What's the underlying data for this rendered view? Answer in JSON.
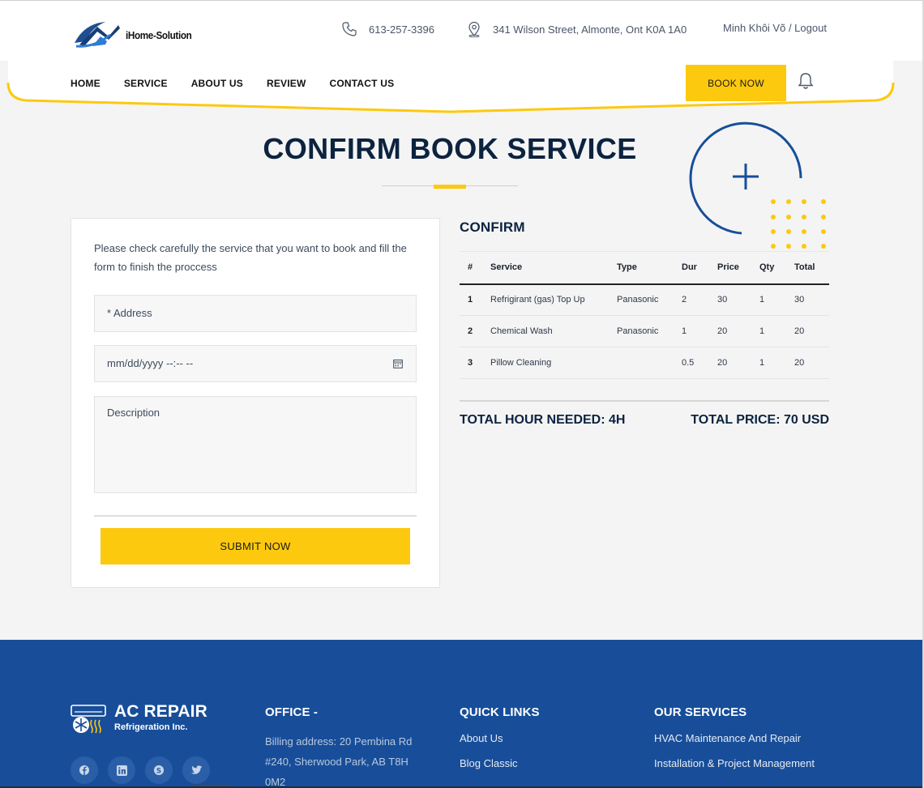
{
  "header": {
    "logo_text": "iHome-Solution",
    "phone": "613-257-3396",
    "address": "341 Wilson Street, Almonte, Ont K0A 1A0",
    "user_name": "Minh Khôi Võ",
    "separator": " / ",
    "logout": "Logout"
  },
  "nav": {
    "items": [
      "HOME",
      "SERVICE",
      "ABOUT US",
      "REVIEW",
      "CONTACT US"
    ],
    "book_now": "BOOK NOW",
    "icons": [
      "bell-icon",
      "phone-icon",
      "location-icon"
    ]
  },
  "page": {
    "title": "CONFIRM BOOK SERVICE"
  },
  "form": {
    "intro": "Please check carefully the service that you want to book and fill the form to finish the proccess",
    "address_placeholder": "* Address",
    "date_placeholder": "mm/dd/yyyy --:-- --",
    "description_placeholder": "Description",
    "submit": "SUBMIT NOW"
  },
  "confirm": {
    "title": "CONFIRM",
    "columns": [
      "#",
      "Service",
      "Type",
      "Dur",
      "Price",
      "Qty",
      "Total"
    ],
    "rows": [
      [
        "1",
        "Refrigirant (gas) Top Up",
        "Panasonic",
        "2",
        "30",
        "1",
        "30"
      ],
      [
        "2",
        "Chemical Wash",
        "Panasonic",
        "1",
        "20",
        "1",
        "20"
      ],
      [
        "3",
        "Pillow Cleaning",
        "",
        "0.5",
        "20",
        "1",
        "20"
      ]
    ],
    "total_hours": "TOTAL HOUR NEEDED: 4H",
    "total_price": "TOTAL PRICE: 70 USD"
  },
  "footer": {
    "brand": "AC REPAIR",
    "brand_sub": "Refrigeration Inc.",
    "office_heading": "OFFICE -",
    "office_text": "Billing address: 20 Pembina Rd #240, Sherwood Park, AB T8H 0M2",
    "links_heading": "QUICK LINKS",
    "links": [
      "About Us",
      "Blog Classic"
    ],
    "services_heading": "OUR SERVICES",
    "services": [
      "HVAC Maintenance And Repair",
      "Installation & Project Management"
    ],
    "social_icons": [
      "facebook-icon",
      "linkedin-icon",
      "skype-icon",
      "twitter-icon"
    ]
  },
  "colors": {
    "accent": "#fdc90f",
    "navy": "#0c2340",
    "footer_bg": "#184e99"
  }
}
